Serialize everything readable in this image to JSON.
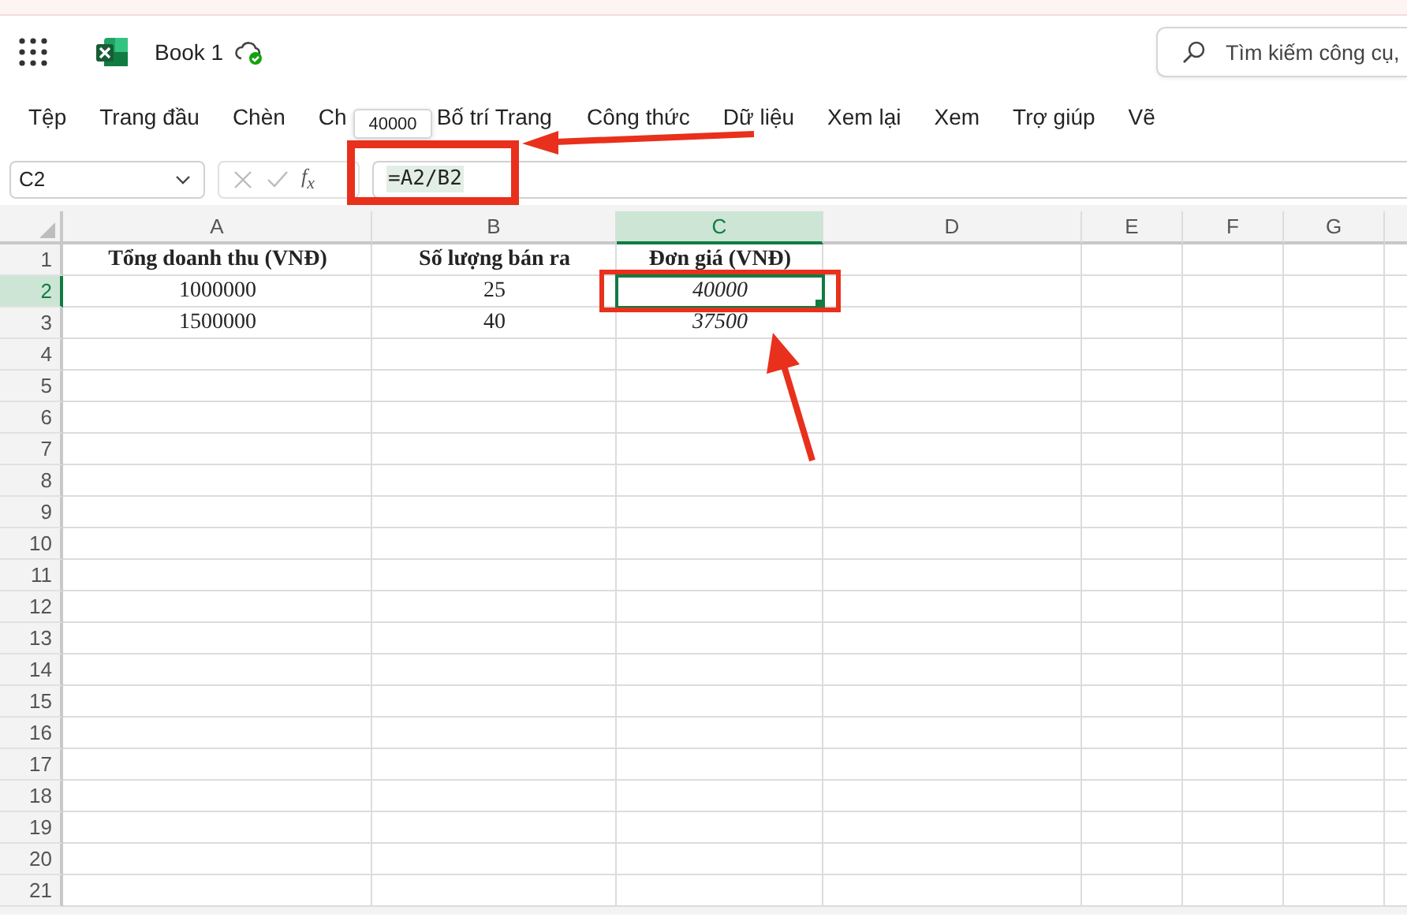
{
  "app_bar": {
    "document_title": "Book 1",
    "search": {
      "placeholder": "Tìm kiếm công cụ,"
    }
  },
  "ribbon_tabs": [
    {
      "label": "Tệp"
    },
    {
      "label": "Trang đầu"
    },
    {
      "label": "Chèn"
    },
    {
      "label": "Ch"
    },
    {
      "label": "Bố trí Trang"
    },
    {
      "label": "Công thức"
    },
    {
      "label": "Dữ liệu"
    },
    {
      "label": "Xem lại"
    },
    {
      "label": "Xem"
    },
    {
      "label": "Trợ giúp"
    },
    {
      "label": "Vẽ"
    }
  ],
  "formula_bar": {
    "name_box": "C2",
    "function_label": "f$_{x}$",
    "formula": "=A2/B2",
    "tooltip": "40000"
  },
  "sheet": {
    "columns": [
      {
        "label": "A",
        "selected": false
      },
      {
        "label": "B",
        "selected": false
      },
      {
        "label": "C",
        "selected": true
      },
      {
        "label": "D",
        "selected": false
      },
      {
        "label": "E",
        "selected": false
      },
      {
        "label": "F",
        "selected": false
      },
      {
        "label": "G",
        "selected": false
      }
    ],
    "rows": [
      {
        "label": "1",
        "selected": false,
        "cells": [
          {
            "text": "Tổng doanh thu (VNĐ)",
            "kind": "header",
            "selected": false
          },
          {
            "text": "Số lượng bán ra",
            "kind": "header",
            "selected": false
          },
          {
            "text": "Đơn giá (VNĐ)",
            "kind": "header",
            "selected": false
          }
        ]
      },
      {
        "label": "2",
        "selected": true,
        "cells": [
          {
            "text": "1000000",
            "kind": "value",
            "selected": false
          },
          {
            "text": "25",
            "kind": "value",
            "selected": false
          },
          {
            "text": "40000",
            "kind": "result",
            "selected": true
          }
        ]
      },
      {
        "label": "3",
        "selected": false,
        "cells": [
          {
            "text": "1500000",
            "kind": "value",
            "selected": false
          },
          {
            "text": "40",
            "kind": "value",
            "selected": false
          },
          {
            "text": "37500",
            "kind": "result",
            "selected": false
          }
        ]
      },
      {
        "label": "4",
        "selected": false
      },
      {
        "label": "5",
        "selected": false
      },
      {
        "label": "6",
        "selected": false
      },
      {
        "label": "7",
        "selected": false
      },
      {
        "label": "8",
        "selected": false
      },
      {
        "label": "9",
        "selected": false
      },
      {
        "label": "10",
        "selected": false
      },
      {
        "label": "11",
        "selected": false
      },
      {
        "label": "12",
        "selected": false
      },
      {
        "label": "13",
        "selected": false
      },
      {
        "label": "14",
        "selected": false
      },
      {
        "label": "15",
        "selected": false
      },
      {
        "label": "16",
        "selected": false
      },
      {
        "label": "17",
        "selected": false
      },
      {
        "label": "18",
        "selected": false
      },
      {
        "label": "19",
        "selected": false
      },
      {
        "label": "20",
        "selected": false
      },
      {
        "label": "21",
        "selected": false
      }
    ]
  }
}
